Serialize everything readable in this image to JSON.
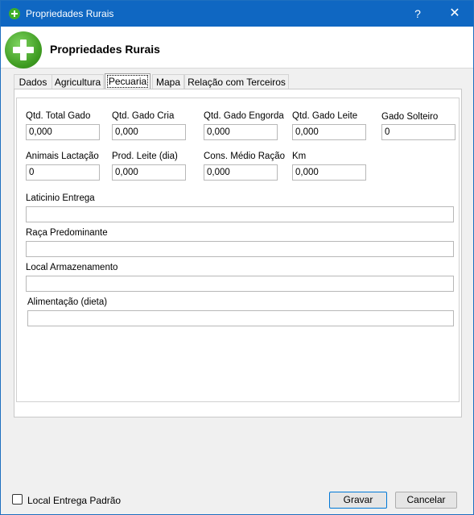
{
  "window": {
    "title": "Propriedades Rurais",
    "help_label": "?",
    "close_label": "✕"
  },
  "header": {
    "title": "Propriedades Rurais"
  },
  "tabs": [
    {
      "label": "Dados"
    },
    {
      "label": "Agricultura"
    },
    {
      "label": "Pecuaria"
    },
    {
      "label": "Mapa"
    },
    {
      "label": "Relação com Terceiros"
    }
  ],
  "active_tab": "Pecuaria",
  "fields": {
    "qtd_total_gado": {
      "label": "Qtd. Total Gado",
      "value": "0,000"
    },
    "qtd_gado_cria": {
      "label": "Qtd. Gado Cria",
      "value": "0,000"
    },
    "qtd_gado_engorda": {
      "label": "Qtd. Gado Engorda",
      "value": "0,000"
    },
    "qtd_gado_leite": {
      "label": "Qtd. Gado Leite",
      "value": "0,000"
    },
    "gado_solteiro": {
      "label": "Gado Solteiro",
      "value": "0"
    },
    "animais_lactacao": {
      "label": "Animais Lactação",
      "value": "0"
    },
    "prod_leite": {
      "label": "Prod. Leite (dia)",
      "value": "0,000"
    },
    "cons_medio_racao": {
      "label": "Cons. Médio Ração",
      "value": "0,000"
    },
    "km": {
      "label": "Km",
      "value": "0,000"
    },
    "laticinio_entrega": {
      "label": "Laticinio Entrega",
      "value": ""
    },
    "raca_predominante": {
      "label": "Raça Predominante",
      "value": ""
    },
    "local_armazenamento": {
      "label": "Local Armazenamento",
      "value": ""
    },
    "alimentacao": {
      "label": "Alimentação (dieta)",
      "value": ""
    }
  },
  "footer": {
    "checkbox_label": "Local Entrega Padrão",
    "checkbox_checked": false,
    "save_label": "Gravar",
    "cancel_label": "Cancelar"
  },
  "colors": {
    "titlebar": "#0f67c2",
    "icon_green": "#3f9c22",
    "accent": "#0078d7"
  },
  "icons": {
    "window": "plus-circle-icon",
    "header": "plus-circle-icon"
  }
}
